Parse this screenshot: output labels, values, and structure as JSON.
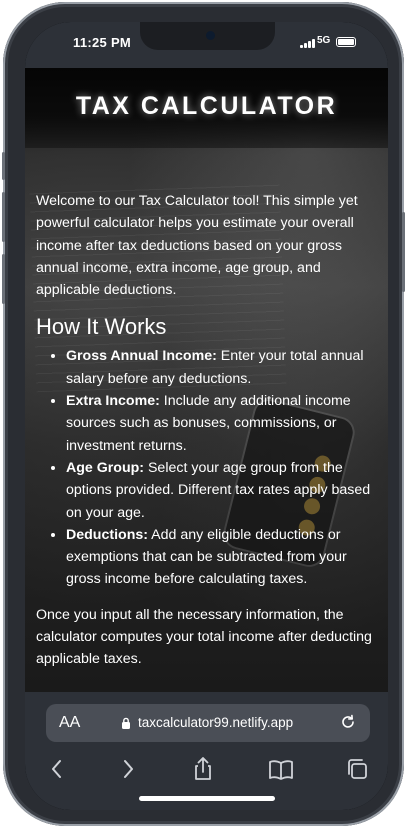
{
  "status_bar": {
    "time": "11:25 PM",
    "network": "5G"
  },
  "header": {
    "title": "TAX CALCULATOR"
  },
  "content": {
    "intro": "Welcome to our Tax Calculator tool! This simple yet powerful calculator helps you estimate your overall income after tax deductions based on your gross annual income, extra income, age group, and applicable deductions.",
    "how_heading": "How It Works",
    "steps": [
      {
        "term": "Gross Annual Income:",
        "desc": " Enter your total annual salary before any deductions."
      },
      {
        "term": "Extra Income:",
        "desc": " Include any additional income sources such as bonuses, commissions, or investment returns."
      },
      {
        "term": "Age Group:",
        "desc": " Select your age group from the options provided. Different tax rates apply based on your age."
      },
      {
        "term": "Deductions:",
        "desc": " Add any eligible deductions or exemptions that can be subtracted from your gross income before calculating taxes."
      }
    ],
    "outro": "Once you input all the necessary information, the calculator computes your total income after deducting applicable taxes."
  },
  "browser": {
    "text_size_label": "AA",
    "url": "taxcalculator99.netlify.app",
    "icons": {
      "back": "chevron-left-icon",
      "forward": "chevron-right-icon",
      "share": "share-icon",
      "bookmarks": "book-icon",
      "tabs": "tabs-icon",
      "reload": "reload-icon",
      "lock": "lock-icon"
    }
  },
  "colors": {
    "frame": "#2a2d33",
    "browser_bar": "#2d3138",
    "url_box": "#4a4e56",
    "text": "#ffffff"
  }
}
